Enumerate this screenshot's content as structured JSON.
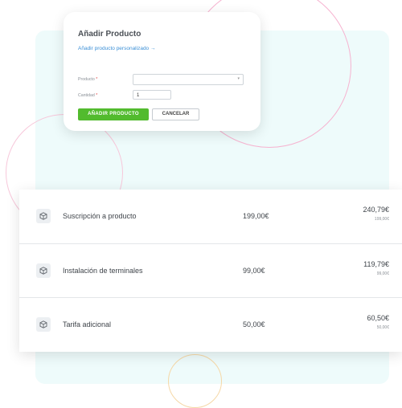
{
  "dialog": {
    "title": "Añadir Producto",
    "custom_link": "Añadir producto personalizado →",
    "product_label": "Producto",
    "quantity_label": "Cantidad",
    "required_mark": "*",
    "product_value": "",
    "quantity_value": "1",
    "add_button": "AÑADIR PRODUCTO",
    "cancel_button": "CANCELAR"
  },
  "products": [
    {
      "name": "Suscripción a producto",
      "price": "199,00€",
      "total": "240,79€",
      "subtotal": "199,00€"
    },
    {
      "name": "Instalación de terminales",
      "price": "99,00€",
      "total": "119,79€",
      "subtotal": "99,00€"
    },
    {
      "name": "Tarifa adicional",
      "price": "50,00€",
      "total": "60,50€",
      "subtotal": "50,00€"
    }
  ],
  "icons": {
    "product": "box-icon",
    "dropdown": "chevron-down-icon"
  },
  "colors": {
    "accent_green": "#52bb2e",
    "link_blue": "#3b8fd6",
    "panel_bg": "#eefbfb",
    "required_red": "#e03d3d"
  }
}
